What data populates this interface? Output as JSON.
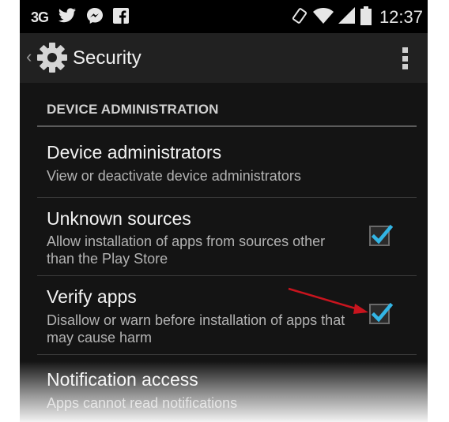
{
  "statusbar": {
    "network": "3G",
    "icons": [
      "twitter-icon",
      "messenger-icon",
      "facebook-icon",
      "rotation-icon",
      "wifi-icon",
      "signal-icon",
      "battery-icon"
    ],
    "time": "12:37"
  },
  "actionbar": {
    "title": "Security",
    "icon": "gear-icon"
  },
  "section": {
    "header": "DEVICE ADMINISTRATION"
  },
  "items": [
    {
      "title": "Device administrators",
      "summary": "View or deactivate device administrators",
      "checked": null
    },
    {
      "title": "Unknown sources",
      "summary": "Allow installation of apps from sources other than the Play Store",
      "checked": true
    },
    {
      "title": "Verify apps",
      "summary": "Disallow or warn before installation of apps that may cause harm",
      "checked": true
    },
    {
      "title": "Notification access",
      "summary": "Apps cannot read notifications",
      "checked": null
    }
  ],
  "colors": {
    "accent": "#33b5e5",
    "annotation_arrow": "#c8141e",
    "background": "#141414",
    "actionbar": "#212121"
  }
}
